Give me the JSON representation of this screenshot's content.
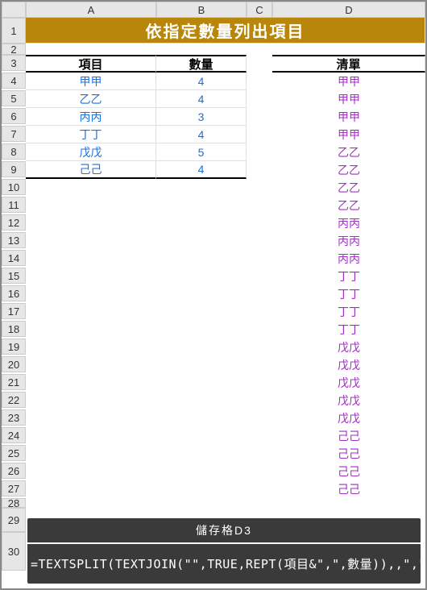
{
  "columns": [
    "A",
    "B",
    "C",
    "D"
  ],
  "title": "依指定數量列出項目",
  "headers": {
    "item": "項目",
    "qty": "數量",
    "list": "清單"
  },
  "rows": [
    {
      "n": 4,
      "item": "甲甲",
      "qty": "4",
      "list": "甲甲"
    },
    {
      "n": 5,
      "item": "乙乙",
      "qty": "4",
      "list": "甲甲"
    },
    {
      "n": 6,
      "item": "丙丙",
      "qty": "3",
      "list": "甲甲"
    },
    {
      "n": 7,
      "item": "丁丁",
      "qty": "4",
      "list": "甲甲"
    },
    {
      "n": 8,
      "item": "戊戊",
      "qty": "5",
      "list": "乙乙"
    },
    {
      "n": 9,
      "item": "己己",
      "qty": "4",
      "list": "乙乙"
    },
    {
      "n": 10,
      "item": "",
      "qty": "",
      "list": "乙乙"
    },
    {
      "n": 11,
      "item": "",
      "qty": "",
      "list": "乙乙"
    },
    {
      "n": 12,
      "item": "",
      "qty": "",
      "list": "丙丙"
    },
    {
      "n": 13,
      "item": "",
      "qty": "",
      "list": "丙丙"
    },
    {
      "n": 14,
      "item": "",
      "qty": "",
      "list": "丙丙"
    },
    {
      "n": 15,
      "item": "",
      "qty": "",
      "list": "丁丁"
    },
    {
      "n": 16,
      "item": "",
      "qty": "",
      "list": "丁丁"
    },
    {
      "n": 17,
      "item": "",
      "qty": "",
      "list": "丁丁"
    },
    {
      "n": 18,
      "item": "",
      "qty": "",
      "list": "丁丁"
    },
    {
      "n": 19,
      "item": "",
      "qty": "",
      "list": "戊戊"
    },
    {
      "n": 20,
      "item": "",
      "qty": "",
      "list": "戊戊"
    },
    {
      "n": 21,
      "item": "",
      "qty": "",
      "list": "戊戊"
    },
    {
      "n": 22,
      "item": "",
      "qty": "",
      "list": "戊戊"
    },
    {
      "n": 23,
      "item": "",
      "qty": "",
      "list": "戊戊"
    },
    {
      "n": 24,
      "item": "",
      "qty": "",
      "list": "己己"
    },
    {
      "n": 25,
      "item": "",
      "qty": "",
      "list": "己己"
    },
    {
      "n": 26,
      "item": "",
      "qty": "",
      "list": "己己"
    },
    {
      "n": 27,
      "item": "",
      "qty": "",
      "list": "己己"
    }
  ],
  "formula_label": "儲存格D3",
  "formula_text": "=TEXTSPLIT(TEXTJOIN(\"\",TRUE,REPT(項目&\",\",數量)),,\",\")",
  "row_29": "29",
  "row_30": "30",
  "row_1": "1",
  "row_2": "2",
  "row_3": "3",
  "row_28": "28"
}
